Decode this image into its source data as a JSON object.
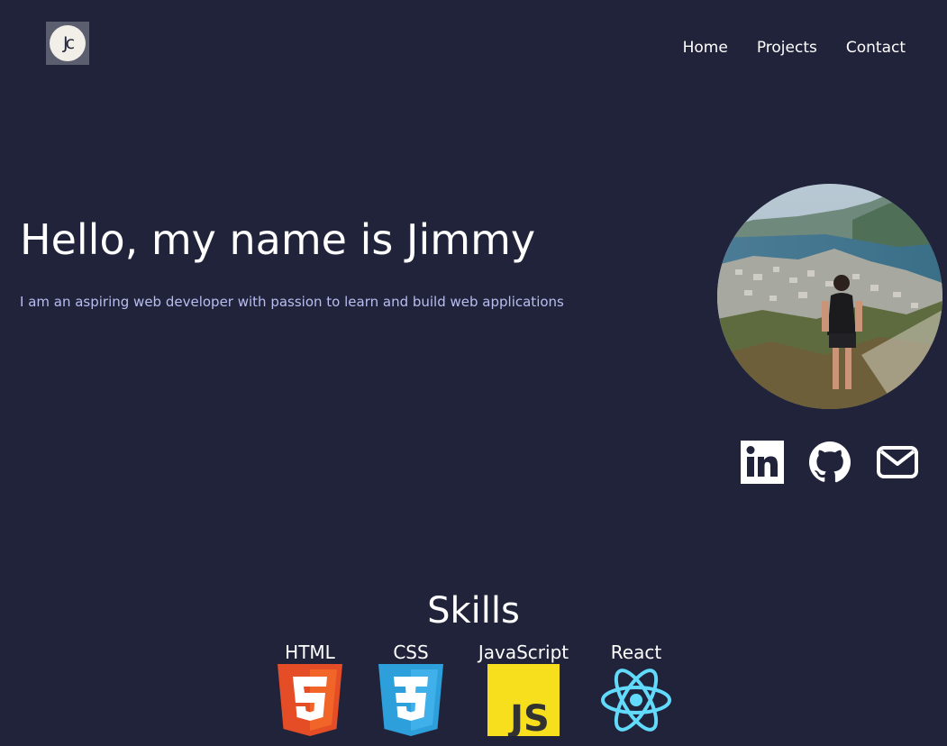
{
  "header": {
    "logo_text": "Jc",
    "nav": [
      "Home",
      "Projects",
      "Contact"
    ]
  },
  "hero": {
    "title": "Hello, my name is Jimmy",
    "subtitle": "I am an aspiring web developer with passion to learn and build web applications"
  },
  "socials": [
    {
      "icon": "linkedin-icon"
    },
    {
      "icon": "github-icon"
    },
    {
      "icon": "mail-icon"
    }
  ],
  "skills": {
    "title": "Skills",
    "items": [
      {
        "label": "HTML",
        "icon": "html5-icon"
      },
      {
        "label": "CSS",
        "icon": "css3-icon"
      },
      {
        "label": "JavaScript",
        "icon": "javascript-icon"
      },
      {
        "label": "React",
        "icon": "react-icon"
      }
    ]
  },
  "colors": {
    "background": "#20233a",
    "subtitle": "#b9bdf0",
    "html5": "#e44d26",
    "css3": "#2d9fdb",
    "javascript": "#f7df1e",
    "react": "#61dafb"
  }
}
